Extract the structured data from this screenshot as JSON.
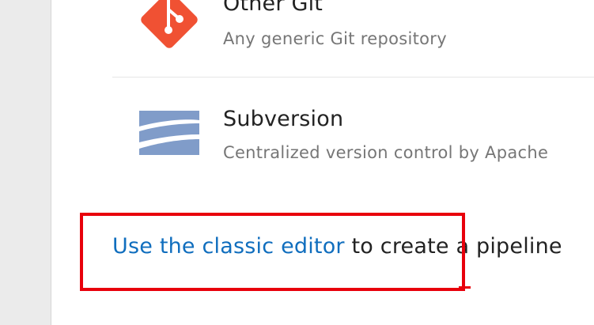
{
  "sources": [
    {
      "title": "Other Git",
      "description": "Any generic Git repository",
      "icon": "git-icon",
      "icon_color": "#f05133"
    },
    {
      "title": "Subversion",
      "description": "Centralized version control by Apache",
      "icon": "subversion-icon",
      "icon_color": "#809cc9"
    }
  ],
  "classic": {
    "link_text": "Use the classic editor",
    "suffix_text": " to create a pipeline"
  },
  "colors": {
    "link": "#106ebe",
    "annotation": "#e8000b",
    "gutter": "#ebebeb"
  }
}
